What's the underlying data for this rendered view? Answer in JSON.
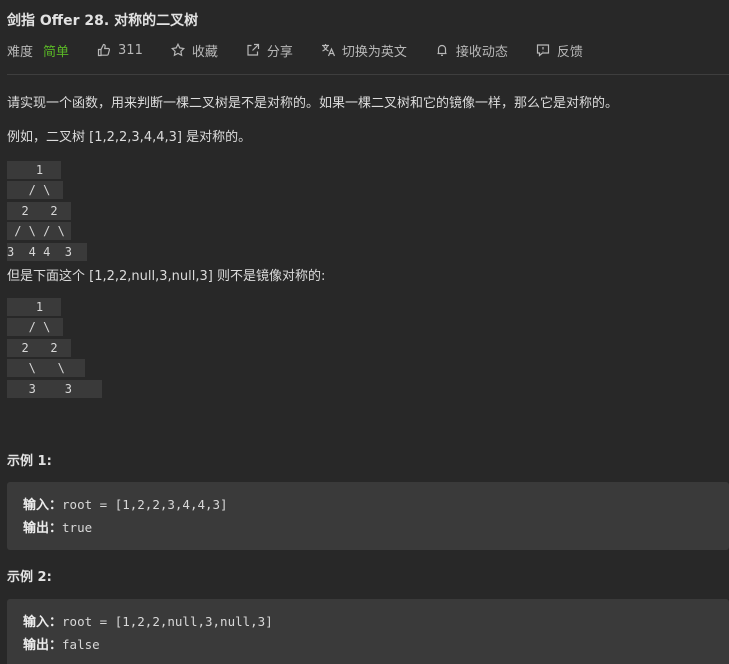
{
  "problem": {
    "title": "剑指 Offer 28. 对称的二叉树",
    "difficulty_label": "难度",
    "difficulty": "简单",
    "likes": "311",
    "actions": {
      "favorite": "收藏",
      "share": "分享",
      "language_switch": "切换为英文",
      "subscribe": "接收动态",
      "feedback": "反馈"
    }
  },
  "description": {
    "intro": "请实现一个函数，用来判断一棵二叉树是不是对称的。如果一棵二叉树和它的镜像一样，那么它是对称的。",
    "symmetric_intro": "例如，二叉树 [1,2,2,3,4,4,3] 是对称的。",
    "symmetric_tree": [
      "    1",
      "   / \\",
      "  2   2",
      " / \\ / \\",
      "3  4 4  3"
    ],
    "asymmetric_intro": "但是下面这个 [1,2,2,null,3,null,3] 则不是镜像对称的:",
    "asymmetric_tree": [
      "    1",
      "   / \\",
      "  2   2",
      "   \\   \\",
      "   3    3"
    ]
  },
  "examples": [
    {
      "title": "示例 1:",
      "input_label": "输入：",
      "input": "root = [1,2,2,3,4,4,3]",
      "output_label": "输出：",
      "output": "true"
    },
    {
      "title": "示例 2:",
      "input_label": "输入：",
      "input": "root = [1,2,2,null,3,null,3]",
      "output_label": "输出：",
      "output": "false"
    }
  ],
  "colors": {
    "background": "#282828",
    "easy": "#5ab726",
    "code_bg": "#3a3a3a"
  }
}
